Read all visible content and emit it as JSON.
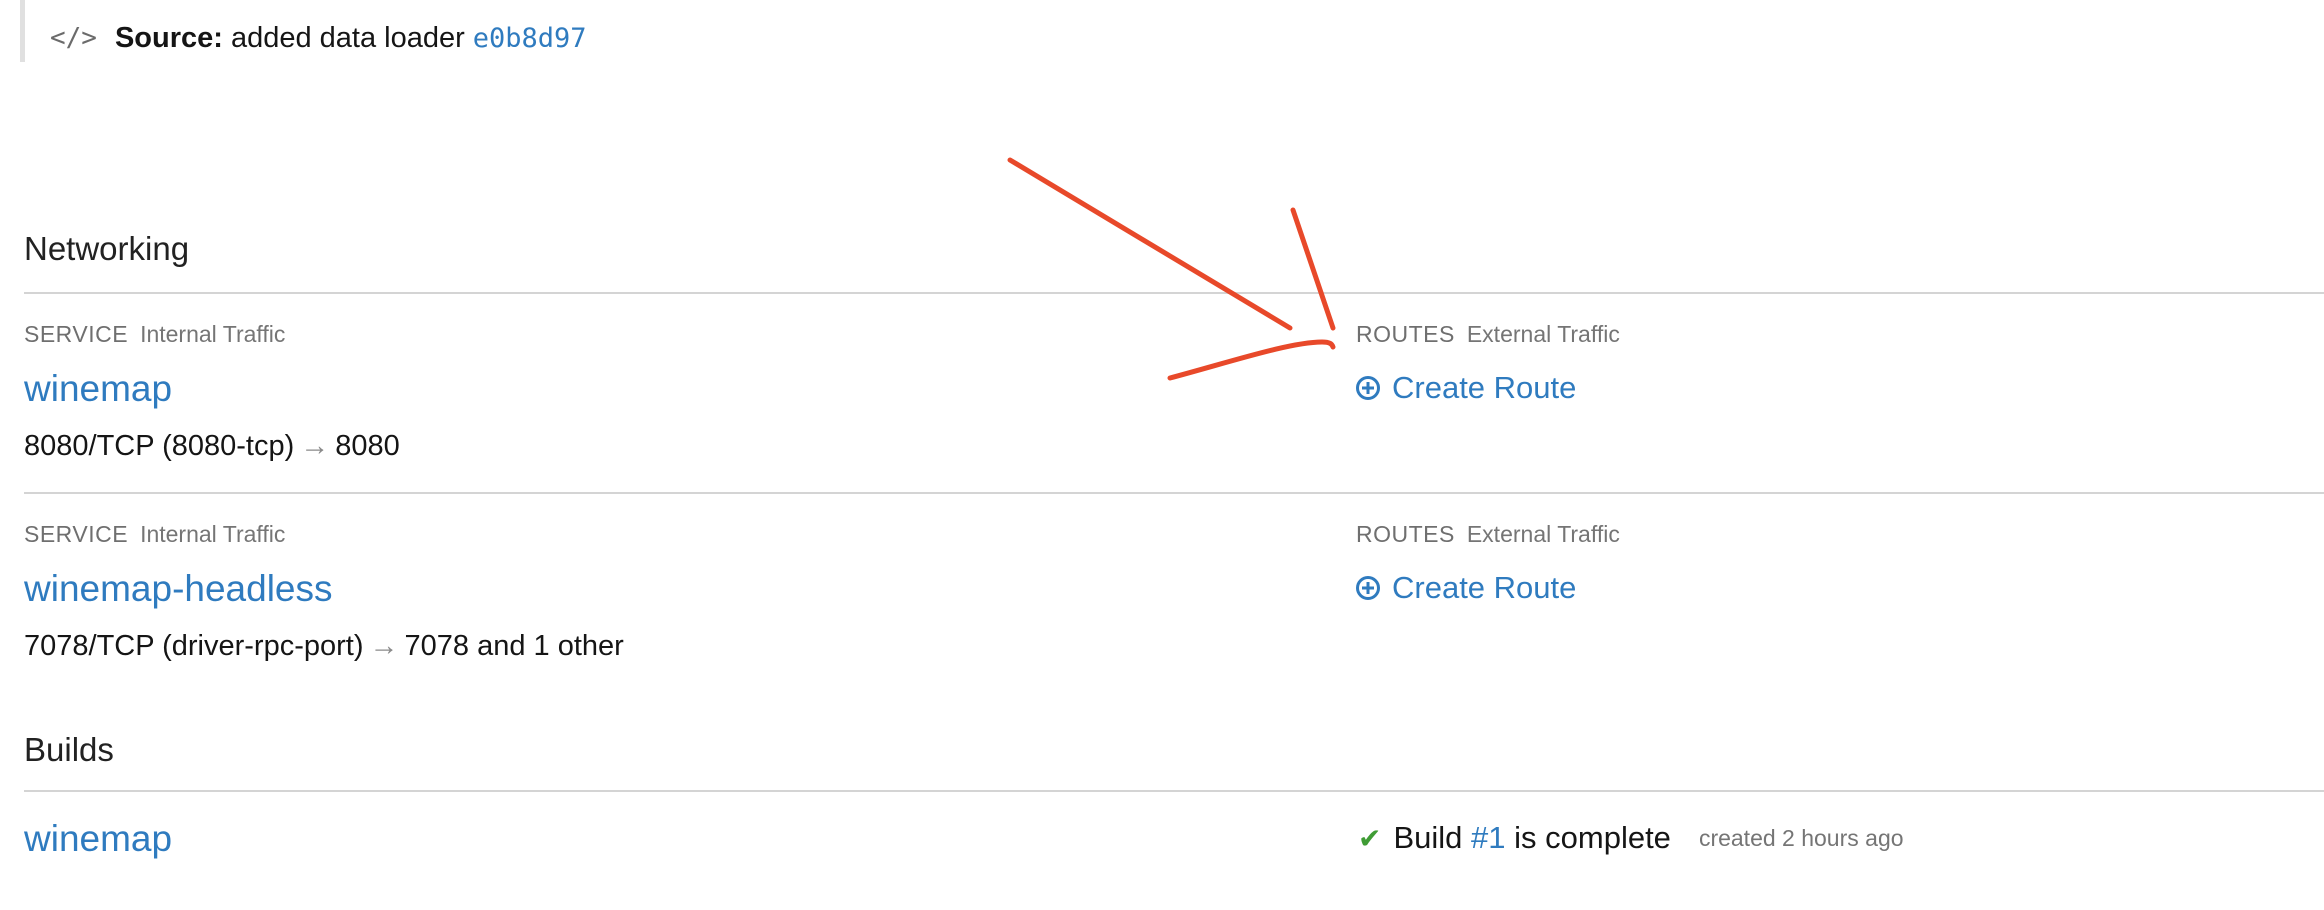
{
  "source": {
    "label": "Source:",
    "message": "added data loader",
    "commit": "e0b8d97"
  },
  "networking": {
    "title": "Networking",
    "services": [
      {
        "service_key": "SERVICE",
        "service_sub": "Internal Traffic",
        "name": "winemap",
        "port": "8080/TCP (8080-tcp)",
        "arrow": "→",
        "target": "8080",
        "routes_key": "ROUTES",
        "routes_sub": "External Traffic",
        "create_route": "Create Route"
      },
      {
        "service_key": "SERVICE",
        "service_sub": "Internal Traffic",
        "name": "winemap-headless",
        "port": "7078/TCP (driver-rpc-port)",
        "arrow": "→",
        "target": "7078 and 1 other",
        "routes_key": "ROUTES",
        "routes_sub": "External Traffic",
        "create_route": "Create Route"
      }
    ]
  },
  "builds": {
    "title": "Builds",
    "items": [
      {
        "name": "winemap",
        "status_prefix": "Build",
        "build_link": "#1",
        "status_suffix": "is complete",
        "created": "created 2 hours ago"
      }
    ]
  },
  "icons": {
    "source": "code-icon",
    "create_route": "plus-circle-icon",
    "build_status": "check-icon"
  },
  "colors": {
    "link": "#2f7bbf",
    "success": "#3f9c35",
    "annotation": "#e8492a"
  }
}
